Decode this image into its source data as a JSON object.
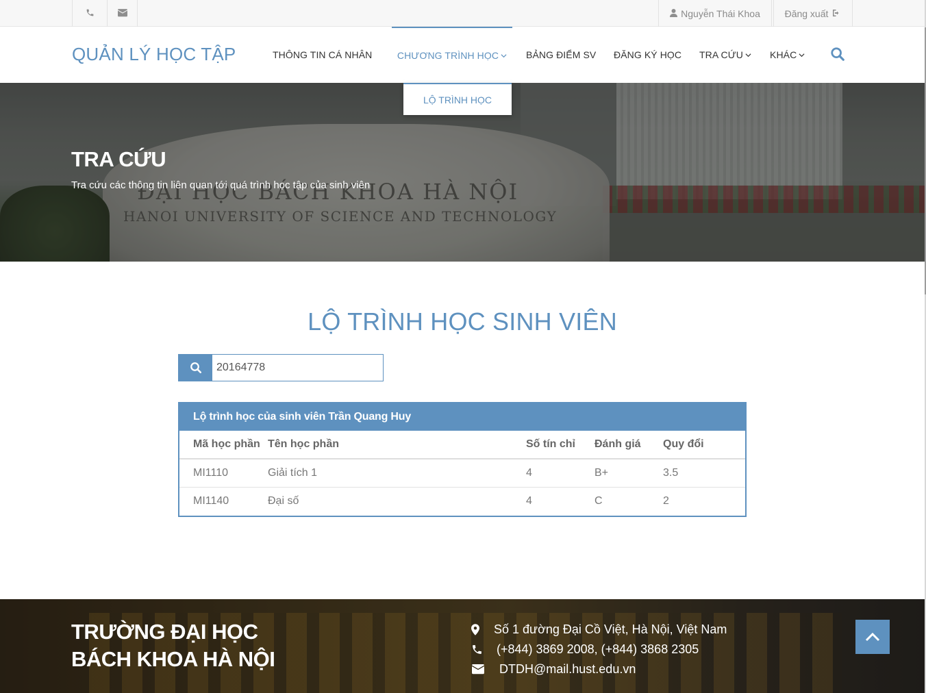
{
  "topbar": {
    "user_name": "Nguyễn Thái Khoa",
    "logout_label": "Đăng xuất"
  },
  "nav": {
    "brand": "QUẢN LÝ HỌC TẬP",
    "items": [
      {
        "label": "THÔNG TIN CÁ NHÂN"
      },
      {
        "label": "CHƯƠNG TRÌNH HỌC"
      },
      {
        "label": "BẢNG ĐIỂM SV"
      },
      {
        "label": "ĐĂNG KÝ HỌC"
      },
      {
        "label": "TRA CỨU"
      },
      {
        "label": "KHÁC"
      }
    ],
    "dropdown_item": "LỘ TRÌNH HỌC"
  },
  "hero": {
    "title": "TRA CỨU",
    "subtitle": "Tra cứu các thông tin liên quan tới quá trình học tập của sinh viên",
    "stone_line1": "ĐẠI HỌC BÁCH KHOA HÀ NỘI",
    "stone_line2": "HANOI UNIVERSITY OF SCIENCE AND TECHNOLOGY"
  },
  "main": {
    "title": "LỘ TRÌNH HỌC SINH VIÊN",
    "search_value": "20164778",
    "panel_title": "Lộ trình học của sinh viên Trần Quang Huy",
    "columns": [
      "Mã học phần",
      "Tên học phần",
      "Số tín chỉ",
      "Đánh giá",
      "Quy đổi"
    ],
    "rows": [
      [
        "MI1110",
        "Giải tích 1",
        "4",
        "B+",
        "3.5"
      ],
      [
        "MI1140",
        "Đại số",
        "4",
        "C",
        "2"
      ]
    ]
  },
  "footer": {
    "title_line1": "TRƯỜNG ĐẠI HỌC",
    "title_line2": "BÁCH KHOA HÀ NỘI",
    "address": "Số 1 đường Đại Cồ Việt, Hà Nội, Việt Nam",
    "phone": "(+844) 3869 2008, (+844) 3868 2305",
    "email": "DTDH@mail.hust.edu.vn"
  },
  "colors": {
    "accent": "#5e91bf"
  }
}
